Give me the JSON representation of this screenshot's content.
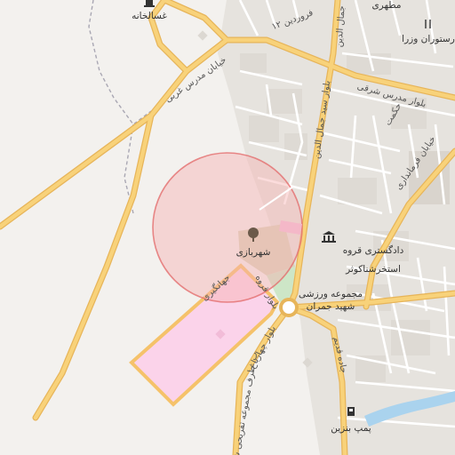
{
  "map": {
    "colors": {
      "land": "#f3f1ee",
      "urban": "#e4e1dc",
      "major_road": "#f8d27a",
      "major_road_casing": "#e7b55a",
      "minor_road": "#ffffff",
      "minor_road_casing": "#d6d2cc",
      "water": "#aad3ee",
      "park": "#cde6c7",
      "pink_zone": "#fbd3ea",
      "pink_zone_border": "#f5c26a",
      "highlight_circle_fill": "#f6b2b2",
      "highlight_circle_stroke": "#e46e6e",
      "path_dashed": "#a9a7b3"
    },
    "highlight": {
      "shape": "circle"
    },
    "places": [
      {
        "id": "ghasalkhaneh",
        "label": "غسالخانه",
        "icon": "landmark-icon"
      },
      {
        "id": "shahrbazi",
        "label": "شهربازی",
        "icon": "tree-icon"
      },
      {
        "id": "dadgostari",
        "label": "دادگستری قروه",
        "icon": "courthouse-icon"
      },
      {
        "id": "estakhr",
        "label": "استخرشناکوثر",
        "icon": ""
      },
      {
        "id": "varzeshi1",
        "label": "مجموعه ورزشی",
        "icon": ""
      },
      {
        "id": "varzeshi2",
        "label": "شهید جمران",
        "icon": ""
      },
      {
        "id": "restaurant",
        "label": "رستوران وزرا",
        "icon": "restaurant-icon"
      },
      {
        "id": "pomp",
        "label": "پمپ بنزین",
        "icon": "fuel-icon"
      },
      {
        "id": "motahari",
        "label": "مطهری",
        "icon": ""
      }
    ],
    "roads": [
      {
        "id": "modares-gharbi",
        "label": "خیابان مدرس غربی"
      },
      {
        "id": "modares-sharghi",
        "label": "بلوار مدرس شرقی"
      },
      {
        "id": "seyed-jamal",
        "label": "بلوار سید جمال الدین"
      },
      {
        "id": "jamal-aldin",
        "label": "جمال الدین"
      },
      {
        "id": "12-farvardin",
        "label": "۱۲ فروردین"
      },
      {
        "id": "hekmat",
        "label": "حکمت"
      },
      {
        "id": "farmandari",
        "label": "خیابان فرمانداری"
      },
      {
        "id": "jahangiri",
        "label": "جهانگیری"
      },
      {
        "id": "ghorveh-blvd",
        "label": "بلوار قروه"
      },
      {
        "id": "chahar-bagh",
        "label": "بلوار چهارباغ"
      },
      {
        "id": "tafrihi",
        "label": "ب. طرف مجموعه تفریحی شهر"
      },
      {
        "id": "jadde-ghadim",
        "label": "جاده قدیم"
      }
    ]
  }
}
